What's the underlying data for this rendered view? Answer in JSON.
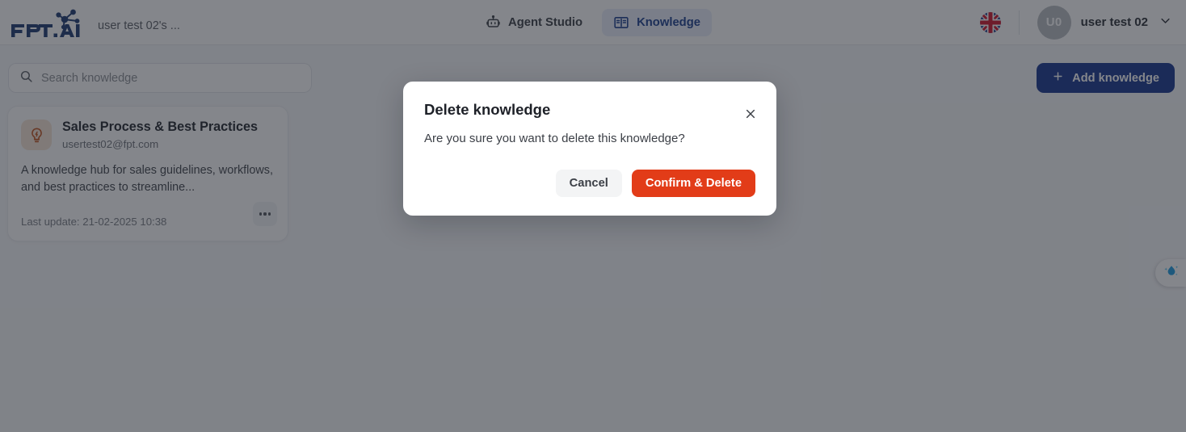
{
  "header": {
    "logo_text": "FPT.AI",
    "workspace_name": "user test 02's ...",
    "nav": [
      {
        "label": "Agent Studio",
        "icon": "robot-icon",
        "active": false
      },
      {
        "label": "Knowledge",
        "icon": "book-icon",
        "active": true
      }
    ],
    "language_icon": "uk-flag-icon",
    "avatar_initials": "U0",
    "user_name": "user test 02",
    "chevron_icon": "chevron-down-icon"
  },
  "toolbar": {
    "search_placeholder": "Search knowledge",
    "search_value": "",
    "search_icon": "search-icon",
    "add_label": "Add knowledge",
    "add_icon": "plus-icon"
  },
  "knowledge_cards": [
    {
      "icon": "lightbulb-icon",
      "title": "Sales Process & Best Practices",
      "email": "usertest02@fpt.com",
      "description": "A knowledge hub for sales guidelines, workflows, and best practices to streamline...",
      "last_update": "Last update: 21-02-2025 10:38",
      "menu_icon": "more-options-icon"
    }
  ],
  "assistant": {
    "icon": "water-drop-sparkle-icon"
  },
  "modal": {
    "title": "Delete knowledge",
    "message": "Are you sure you want to delete this knowledge?",
    "close_icon": "close-icon",
    "cancel_label": "Cancel",
    "confirm_label": "Confirm & Delete"
  },
  "colors": {
    "brand_navy": "#17378f",
    "danger_red": "#e23c18",
    "active_tab_bg": "#e8eefb",
    "active_tab_text": "#1b3e8f",
    "card_icon_bg": "#f7e5d6",
    "overlay": "rgba(31,35,43,.55)"
  }
}
